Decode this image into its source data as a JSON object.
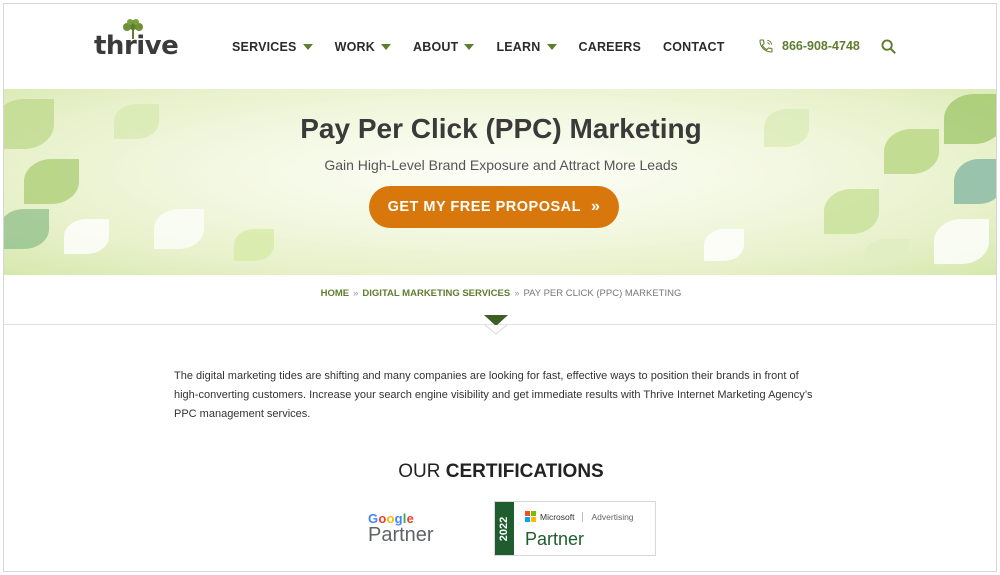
{
  "header": {
    "logo_text": "thrive",
    "nav": [
      {
        "label": "SERVICES",
        "dropdown": true
      },
      {
        "label": "WORK",
        "dropdown": true
      },
      {
        "label": "ABOUT",
        "dropdown": true
      },
      {
        "label": "LEARN",
        "dropdown": true
      },
      {
        "label": "CAREERS",
        "dropdown": false
      },
      {
        "label": "CONTACT",
        "dropdown": false
      }
    ],
    "phone": "866-908-4748"
  },
  "hero": {
    "title": "Pay Per Click (PPC) Marketing",
    "subtitle": "Gain High-Level Brand Exposure and Attract More Leads",
    "cta_label": "GET MY FREE PROPOSAL",
    "cta_arrow": "»"
  },
  "breadcrumb": {
    "home": "HOME",
    "sep": "»",
    "parent": "DIGITAL MARKETING SERVICES",
    "current": "PAY PER CLICK (PPC) MARKETING"
  },
  "intro": {
    "text": "The digital marketing tides are shifting and many companies are looking for fast, effective ways to position their brands in front of high-converting customers. Increase your search engine visibility and get immediate results with Thrive Internet Marketing Agency’s PPC management services."
  },
  "certifications": {
    "title_light": "OUR ",
    "title_bold": "CERTIFICATIONS",
    "google": {
      "brand": "Google",
      "partner": "Partner"
    },
    "microsoft": {
      "year": "2022",
      "brand": "Microsoft",
      "division": "Advertising",
      "partner": "Partner"
    }
  },
  "colors": {
    "accent_green": "#5f7d2f",
    "cta_orange": "#d8780c",
    "ms_green": "#1f5c2e"
  }
}
